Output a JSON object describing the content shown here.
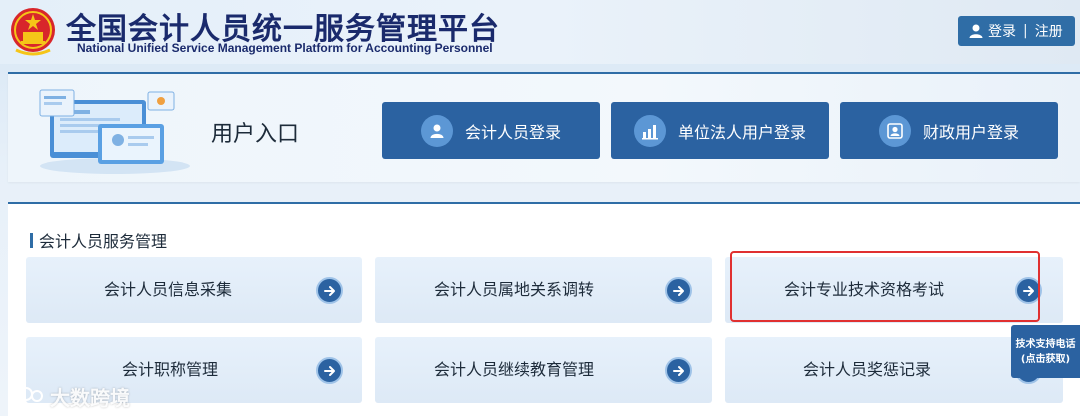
{
  "header": {
    "title_cn": "全国会计人员统一服务管理平台",
    "title_en": "National Unified Service Management Platform for Accounting Personnel",
    "login_label": "登录",
    "separator": "|",
    "register_label": "注册"
  },
  "entry": {
    "title": "用户入口",
    "buttons": [
      {
        "label": "会计人员登录",
        "icon": "person-icon"
      },
      {
        "label": "单位法人用户登录",
        "icon": "building-chart-icon"
      },
      {
        "label": "财政用户登录",
        "icon": "user-card-icon"
      }
    ]
  },
  "service": {
    "heading": "会计人员服务管理",
    "cards": [
      {
        "label": "会计人员信息采集"
      },
      {
        "label": "会计人员属地关系调转"
      },
      {
        "label": "会计专业技术资格考试"
      },
      {
        "label": "会计职称管理"
      },
      {
        "label": "会计人员继续教育管理"
      },
      {
        "label": "会计人员奖惩记录"
      }
    ]
  },
  "support": {
    "line1": "技术支持电话",
    "line2": "(点击获取)"
  },
  "watermark": {
    "text": "大数跨境"
  },
  "colors": {
    "primary": "#2b62a1",
    "title": "#1a2a6c",
    "highlight": "#e03030"
  }
}
